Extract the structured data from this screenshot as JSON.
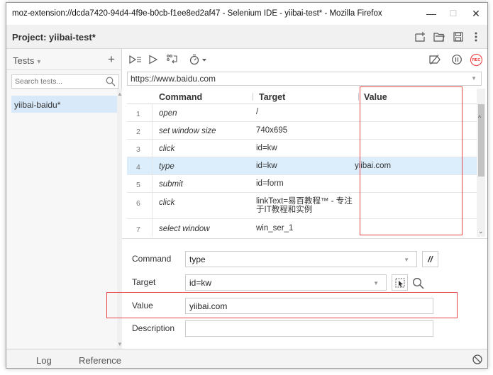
{
  "window": {
    "title": "moz-extension://dcda7420-94d4-4f9e-b0cb-f1ee8ed2af47 - Selenium IDE - yiibai-test* - Mozilla Firefox",
    "minimize": "—",
    "maximize": "☐",
    "close": "✕"
  },
  "project": {
    "label": "Project:",
    "name": "yiibai-test*",
    "full": "Project: yiibai-test*"
  },
  "sidebar": {
    "tests_label": "Tests",
    "tests_caret": "▾",
    "add": "+",
    "search_placeholder": "Search tests...",
    "tests": [
      {
        "name": "yiibai-baidu*",
        "selected": true
      }
    ]
  },
  "toolbar": {
    "run_all": "▷≡",
    "run": "▷",
    "step": "step",
    "speed": "speed",
    "disable_breakpoints": "disable-breakpoints",
    "pause_exceptions": "pause",
    "record": "REC"
  },
  "url": {
    "value": "https://www.baidu.com"
  },
  "table": {
    "headers": {
      "command": "Command",
      "target": "Target",
      "value": "Value"
    },
    "rows": [
      {
        "num": "1",
        "command": "open",
        "target": "/",
        "value": ""
      },
      {
        "num": "2",
        "command": "set window size",
        "target": "740x695",
        "value": ""
      },
      {
        "num": "3",
        "command": "click",
        "target": "id=kw",
        "value": ""
      },
      {
        "num": "4",
        "command": "type",
        "target": "id=kw",
        "value": "yiibai.com",
        "selected": true
      },
      {
        "num": "5",
        "command": "submit",
        "target": "id=form",
        "value": ""
      },
      {
        "num": "6",
        "command": "click",
        "target_line1": "linkText=易百教程™ - 专注",
        "target_line2": "于IT教程和实例",
        "value": ""
      },
      {
        "num": "7",
        "command": "select window",
        "target": "win_ser_1",
        "value": ""
      }
    ]
  },
  "editor": {
    "command_label": "Command",
    "command_value": "type",
    "comment_btn": "//",
    "target_label": "Target",
    "target_value": "id=kw",
    "value_label": "Value",
    "value_value": "yiibai.com",
    "description_label": "Description",
    "description_value": ""
  },
  "bottom": {
    "tabs": [
      "Log",
      "Reference"
    ]
  },
  "colors": {
    "accent": "#3c8be0",
    "selected_row": "#dceefb",
    "highlight_box": "#e8454a",
    "record": "#e33333"
  }
}
